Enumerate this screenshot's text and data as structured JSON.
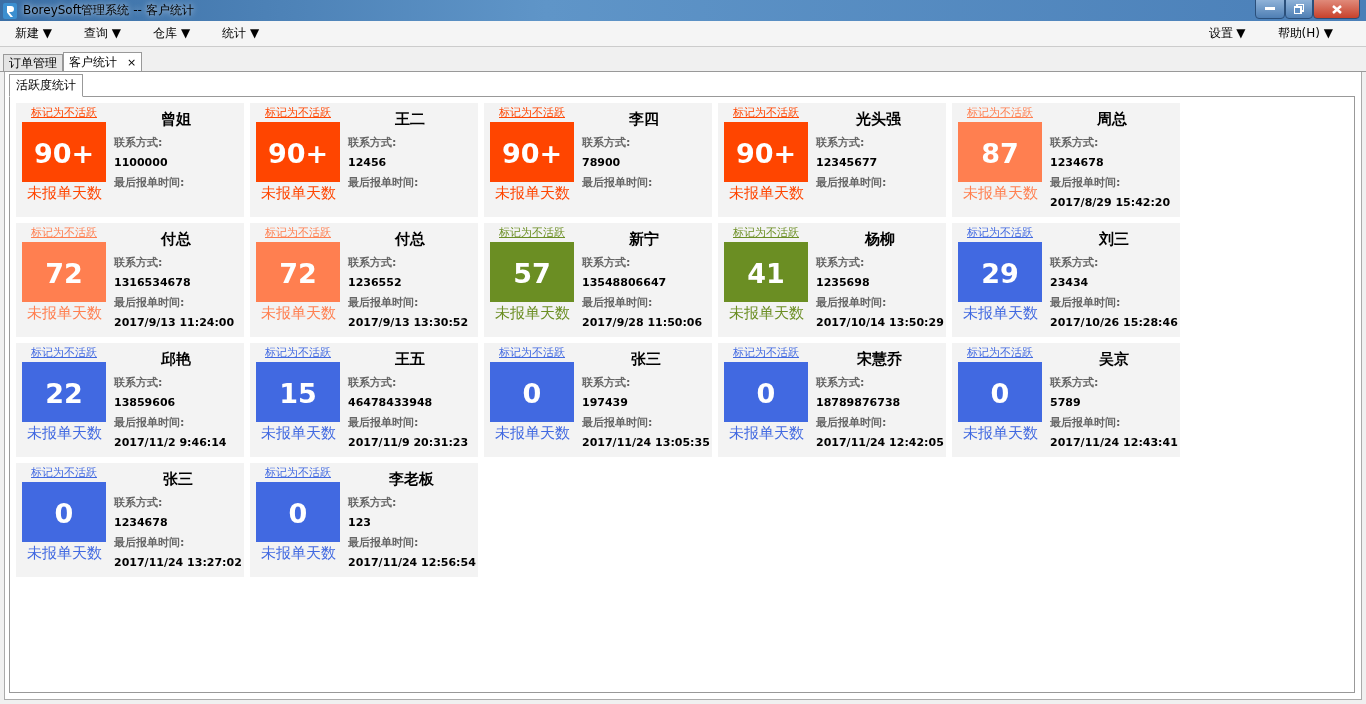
{
  "window": {
    "title": "BoreySoft管理系统 -- 客户统计"
  },
  "menu_left": [
    {
      "label": "新建 ▼"
    },
    {
      "label": "查询 ▼"
    },
    {
      "label": "仓库 ▼"
    },
    {
      "label": "统计 ▼"
    }
  ],
  "menu_right": [
    {
      "label": "设置 ▼"
    },
    {
      "label": "帮助(H) ▼"
    }
  ],
  "tabs": [
    {
      "label": "订单管理",
      "selected": false
    },
    {
      "label": "客户统计",
      "selected": true,
      "close": "×"
    }
  ],
  "subtabs": [
    {
      "label": "活跃度统计",
      "selected": true
    }
  ],
  "cards": [
    {
      "link": "标记为不活跃",
      "days": "90+",
      "caption": "未报单天数",
      "color": "#ff4500",
      "name": "曾姐",
      "contact_label": "联系方式:",
      "contact": "1100000",
      "last_label": "最后报单时间:"
    },
    {
      "link": "标记为不活跃",
      "days": "90+",
      "caption": "未报单天数",
      "color": "#ff4500",
      "name": "王二",
      "contact_label": "联系方式:",
      "contact": "12456",
      "last_label": "最后报单时间:"
    },
    {
      "link": "标记为不活跃",
      "days": "90+",
      "caption": "未报单天数",
      "color": "#ff4500",
      "name": "李四",
      "contact_label": "联系方式:",
      "contact": "78900",
      "last_label": "最后报单时间:"
    },
    {
      "link": "标记为不活跃",
      "days": "90+",
      "caption": "未报单天数",
      "color": "#ff4500",
      "name": "光头强",
      "contact_label": "联系方式:",
      "contact": "12345677",
      "last_label": "最后报单时间:"
    },
    {
      "link": "标记为不活跃",
      "days": "87",
      "caption": "未报单天数",
      "color": "#ff7f50",
      "name": "周总",
      "contact_label": "联系方式:",
      "contact": "1234678",
      "last_label": "最后报单时间:",
      "last": "2017/8/29 15:42:20"
    },
    {
      "link": "标记为不活跃",
      "days": "72",
      "caption": "未报单天数",
      "color": "#ff7f50",
      "name": "付总",
      "contact_label": "联系方式:",
      "contact": "1316534678",
      "last_label": "最后报单时间:",
      "last": "2017/9/13 11:24:00"
    },
    {
      "link": "标记为不活跃",
      "days": "72",
      "caption": "未报单天数",
      "color": "#ff7f50",
      "name": "付总",
      "contact_label": "联系方式:",
      "contact": "1236552",
      "last_label": "最后报单时间:",
      "last": "2017/9/13 13:30:52"
    },
    {
      "link": "标记为不活跃",
      "days": "57",
      "caption": "未报单天数",
      "color": "#6b8e23",
      "name": "新宁",
      "contact_label": "联系方式:",
      "contact": "13548806647",
      "last_label": "最后报单时间:",
      "last": "2017/9/28 11:50:06"
    },
    {
      "link": "标记为不活跃",
      "days": "41",
      "caption": "未报单天数",
      "color": "#6b8e23",
      "name": "杨柳",
      "contact_label": "联系方式:",
      "contact": "1235698",
      "last_label": "最后报单时间:",
      "last": "2017/10/14 13:50:29"
    },
    {
      "link": "标记为不活跃",
      "days": "29",
      "caption": "未报单天数",
      "color": "#4169e1",
      "name": "刘三",
      "contact_label": "联系方式:",
      "contact": "23434",
      "last_label": "最后报单时间:",
      "last": "2017/10/26 15:28:46"
    },
    {
      "link": "标记为不活跃",
      "days": "22",
      "caption": "未报单天数",
      "color": "#4169e1",
      "name": "邱艳",
      "contact_label": "联系方式:",
      "contact": "13859606",
      "last_label": "最后报单时间:",
      "last": "2017/11/2 9:46:14"
    },
    {
      "link": "标记为不活跃",
      "days": "15",
      "caption": "未报单天数",
      "color": "#4169e1",
      "name": "王五",
      "contact_label": "联系方式:",
      "contact": "46478433948",
      "last_label": "最后报单时间:",
      "last": "2017/11/9 20:31:23"
    },
    {
      "link": "标记为不活跃",
      "days": "0",
      "caption": "未报单天数",
      "color": "#4169e1",
      "name": "张三",
      "contact_label": "联系方式:",
      "contact": "197439",
      "last_label": "最后报单时间:",
      "last": "2017/11/24 13:05:35"
    },
    {
      "link": "标记为不活跃",
      "days": "0",
      "caption": "未报单天数",
      "color": "#4169e1",
      "name": "宋慧乔",
      "contact_label": "联系方式:",
      "contact": "18789876738",
      "last_label": "最后报单时间:",
      "last": "2017/11/24 12:42:05"
    },
    {
      "link": "标记为不活跃",
      "days": "0",
      "caption": "未报单天数",
      "color": "#4169e1",
      "name": "吴京",
      "contact_label": "联系方式:",
      "contact": "5789",
      "last_label": "最后报单时间:",
      "last": "2017/11/24 12:43:41"
    },
    {
      "link": "标记为不活跃",
      "days": "0",
      "caption": "未报单天数",
      "color": "#4169e1",
      "name": "张三",
      "contact_label": "联系方式:",
      "contact": "1234678",
      "last_label": "最后报单时间:",
      "last": "2017/11/24 13:27:02"
    },
    {
      "link": "标记为不活跃",
      "days": "0",
      "caption": "未报单天数",
      "color": "#4169e1",
      "name": "李老板",
      "contact_label": "联系方式:",
      "contact": "123",
      "last_label": "最后报单时间:",
      "last": "2017/11/24 12:56:54"
    }
  ]
}
